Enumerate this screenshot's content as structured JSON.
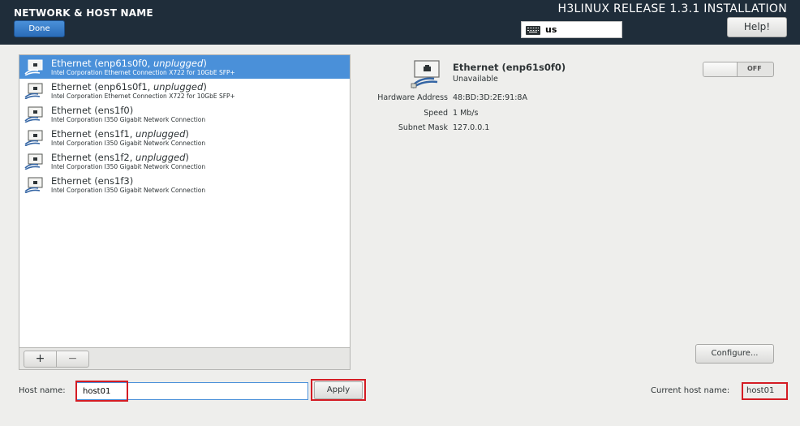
{
  "header": {
    "section_title": "NETWORK & HOST NAME",
    "done_label": "Done",
    "release_title": "H3LINUX RELEASE 1.3.1 INSTALLATION",
    "keyboard_layout": "us",
    "help_label": "Help!"
  },
  "devices": [
    {
      "name": "Ethernet (enp61s0f0, ",
      "state": "unplugged",
      "desc": "Intel Corporation Ethernet Connection X722 for 10GbE SFP+",
      "selected": true
    },
    {
      "name": "Ethernet (enp61s0f1, ",
      "state": "unplugged",
      "desc": "Intel Corporation Ethernet Connection X722 for 10GbE SFP+",
      "selected": false
    },
    {
      "name": "Ethernet (ens1f0)",
      "state": "",
      "desc": "Intel Corporation I350 Gigabit Network Connection",
      "selected": false
    },
    {
      "name": "Ethernet (ens1f1, ",
      "state": "unplugged",
      "desc": "Intel Corporation I350 Gigabit Network Connection",
      "selected": false
    },
    {
      "name": "Ethernet (ens1f2, ",
      "state": "unplugged",
      "desc": "Intel Corporation I350 Gigabit Network Connection",
      "selected": false
    },
    {
      "name": "Ethernet (ens1f3)",
      "state": "",
      "desc": "Intel Corporation I350 Gigabit Network Connection",
      "selected": false
    }
  ],
  "list_toolbar": {
    "add_label": "+",
    "remove_label": "−"
  },
  "details": {
    "name": "Ethernet (enp61s0f0)",
    "status": "Unavailable",
    "hw_label": "Hardware Address",
    "hw_value": "48:BD:3D:2E:91:8A",
    "speed_label": "Speed",
    "speed_value": "1 Mb/s",
    "mask_label": "Subnet Mask",
    "mask_value": "127.0.0.1",
    "toggle_label": "OFF",
    "configure_label": "Configure..."
  },
  "hostname": {
    "label": "Host name:",
    "value": "host01",
    "apply_label": "Apply",
    "current_label": "Current host name:",
    "current_value": "host01"
  },
  "colors": {
    "header_bg": "#1f2d3a",
    "selection": "#4a90d9",
    "highlight_box": "#d41c24"
  }
}
